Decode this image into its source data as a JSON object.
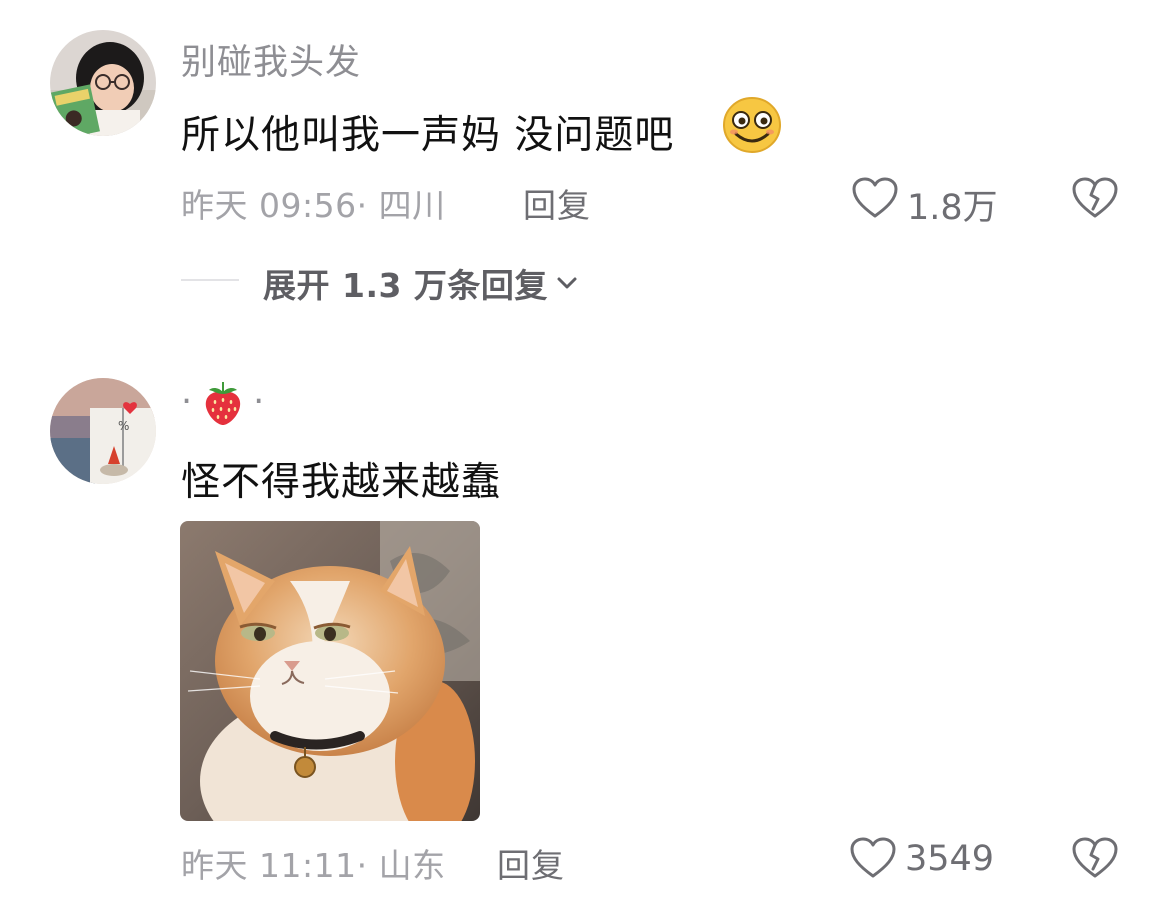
{
  "comments": [
    {
      "username": "别碰我头发",
      "text": "所以他叫我一声妈 没问题吧",
      "emoji": "smile-emoji",
      "meta": "昨天 09:56· 四川",
      "reply_label": "回复",
      "likes": "1.8万",
      "expand_label": "展开 1.3 万条回复"
    },
    {
      "username_prefix": "·",
      "username_suffix": "·",
      "username_icon": "strawberry-icon",
      "text": "怪不得我越来越蠢",
      "image": "cat-photo",
      "meta": "昨天 11:11· 山东",
      "reply_label": "回复",
      "likes": "3549"
    }
  ],
  "colors": {
    "meta_gray": "#a3a3a8",
    "username_gray": "#8e8e93",
    "text": "#111111"
  }
}
